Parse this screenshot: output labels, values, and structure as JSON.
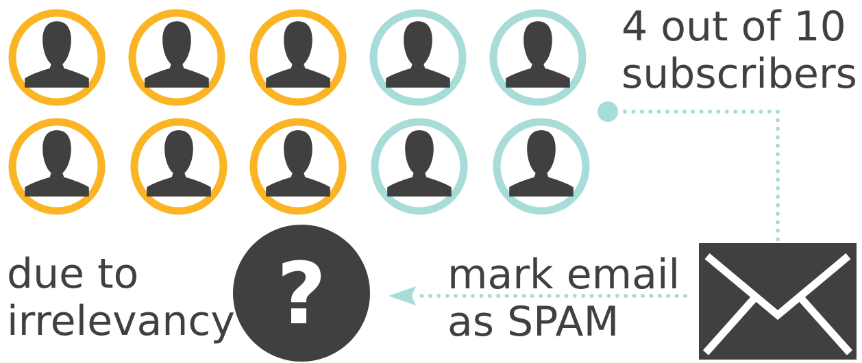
{
  "diagram": {
    "subscriber_count": 10,
    "unhappy_subscriber_count": 4,
    "subscriber_caption": {
      "line1": "4 out of 10",
      "line2": "subscribers"
    },
    "action_caption": {
      "line1": "mark email",
      "line2": "as SPAM"
    },
    "reason_caption": {
      "line1": "due to",
      "line2": "irrelevancy"
    },
    "question_mark": "?"
  },
  "icons": {
    "subscriber": "person-icon",
    "email": "envelope-icon",
    "unknown": "question-mark-icon"
  },
  "colors": {
    "ring_default": "#FBB424",
    "ring_highlight": "#A8DCD8",
    "dark": "#404040",
    "text": "#404040",
    "connector": "#A8DCD8"
  }
}
